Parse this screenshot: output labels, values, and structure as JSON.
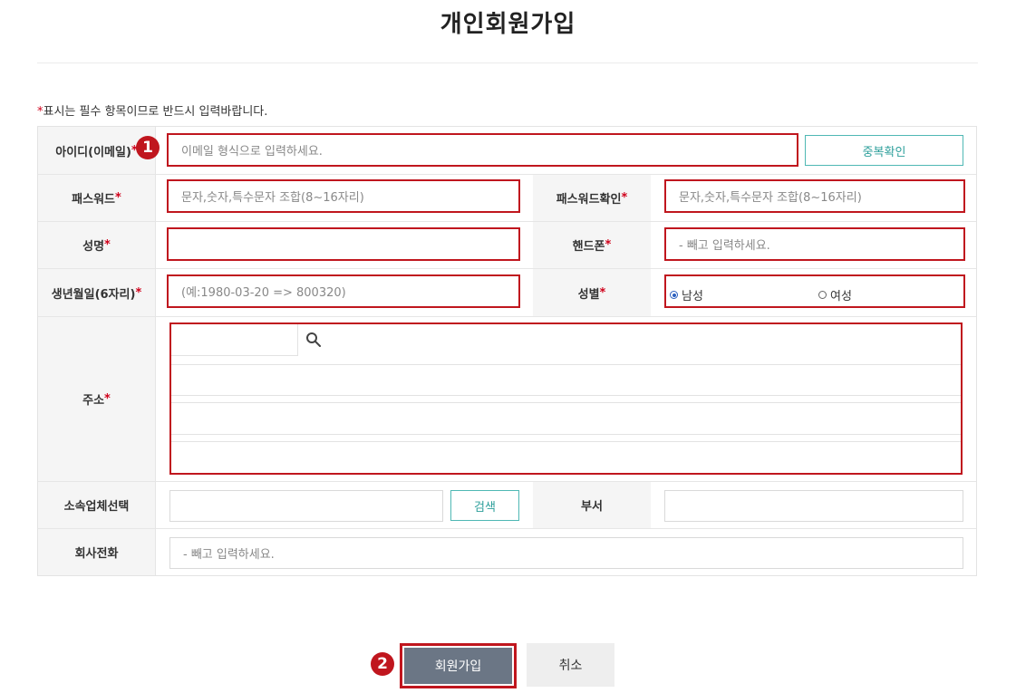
{
  "page": {
    "title": "개인회원가입",
    "notice_mark": "*",
    "notice_text": "표시는 필수 항목이므로 반드시 입력바랍니다."
  },
  "form": {
    "id": {
      "label": "아이디(이메일)",
      "required_mark": "*",
      "placeholder": "이메일 형식으로 입력하세요.",
      "check_button": "중복확인"
    },
    "password": {
      "label": "패스워드",
      "required_mark": "*",
      "placeholder": "문자,숫자,특수문자 조합(8~16자리)"
    },
    "password_confirm": {
      "label": "패스워드확인",
      "required_mark": "*",
      "placeholder": "문자,숫자,특수문자 조합(8~16자리)"
    },
    "name": {
      "label": "성명",
      "required_mark": "*",
      "value": ""
    },
    "phone": {
      "label": "핸드폰",
      "required_mark": "*",
      "placeholder": "- 빼고 입력하세요."
    },
    "birth": {
      "label": "생년월일(6자리)",
      "required_mark": "*",
      "placeholder": "(예:1980-03-20 => 800320)"
    },
    "gender": {
      "label": "성별",
      "required_mark": "*",
      "options": [
        "남성",
        "여성"
      ],
      "selected": "남성"
    },
    "address": {
      "label": "주소",
      "required_mark": "*",
      "search_icon": "search-icon"
    },
    "company": {
      "label": "소속업체선택",
      "search_button": "검색"
    },
    "department": {
      "label": "부서"
    },
    "company_phone": {
      "label": "회사전화",
      "placeholder": "- 빼고 입력하세요."
    }
  },
  "annotations": {
    "step1": "1",
    "step2": "2"
  },
  "actions": {
    "submit": "회원가입",
    "cancel": "취소"
  },
  "colors": {
    "highlight": "#c0161e",
    "accent": "#4fb8b4",
    "submit_bg": "#6b7685"
  }
}
